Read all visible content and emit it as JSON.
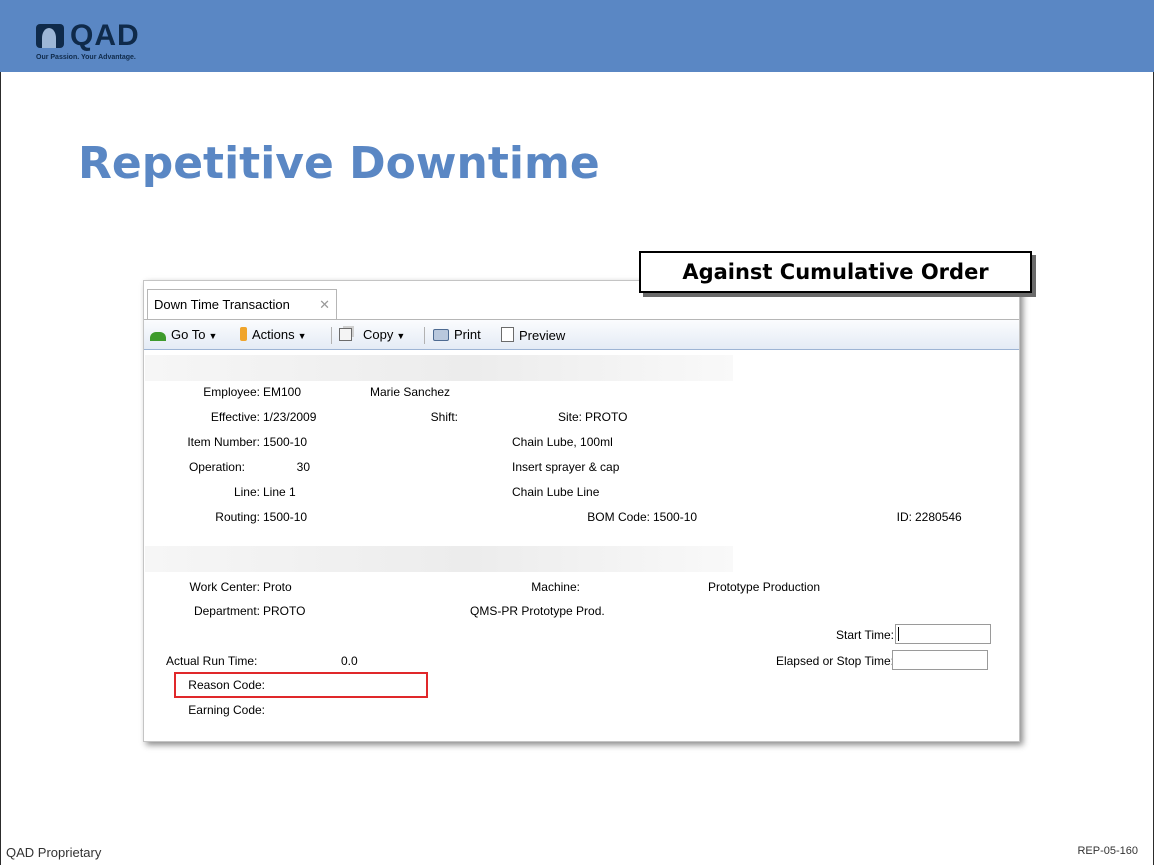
{
  "brand": {
    "name": "QAD",
    "tagline": "Our Passion. Your Advantage."
  },
  "slide": {
    "title": "Repetitive Downtime",
    "callout": "Against Cumulative Order",
    "footer_left": "QAD Proprietary",
    "footer_right": "REP-05-160"
  },
  "window": {
    "tab_label": "Down Time Transaction",
    "tab_close": "✕",
    "toolbar": {
      "goto": "Go To",
      "actions": "Actions",
      "copy": "Copy",
      "print": "Print",
      "preview": "Preview",
      "dropdown_glyph": "▼"
    }
  },
  "header_fields": {
    "employee_label": "Employee:",
    "employee_value": "EM100",
    "employee_name": "Marie Sanchez",
    "effective_label": "Effective:",
    "effective_value": "1/23/2009",
    "shift_label": "Shift:",
    "site_label": "Site:",
    "site_value": "PROTO",
    "item_label": "Item Number:",
    "item_value": "1500-10",
    "item_desc": "Chain Lube, 100ml",
    "operation_label": "Operation:",
    "operation_value": "30",
    "operation_desc": "Insert sprayer & cap",
    "line_label": "Line:",
    "line_value": "Line 1",
    "line_desc": "Chain Lube Line",
    "routing_label": "Routing:",
    "routing_value": "1500-10",
    "bom_label": "BOM Code:",
    "bom_value": "1500-10",
    "id_label": "ID:",
    "id_value": "2280546"
  },
  "detail_fields": {
    "work_center_label": "Work Center:",
    "work_center_value": "Proto",
    "machine_label": "Machine:",
    "machine_desc": "Prototype Production",
    "department_label": "Department:",
    "department_value": "PROTO",
    "department_desc": "QMS-PR Prototype Prod.",
    "start_time_label": "Start Time:",
    "start_time_value": "",
    "actual_run_label": "Actual Run Time:",
    "actual_run_value": "0.0",
    "elapsed_label": "Elapsed or Stop Time:",
    "elapsed_value": "",
    "reason_code_label": "Reason Code:",
    "earning_code_label": "Earning Code:"
  },
  "colors": {
    "header_bar": "#5a87c4",
    "title": "#5a87c4",
    "highlight": "#e0282a"
  }
}
